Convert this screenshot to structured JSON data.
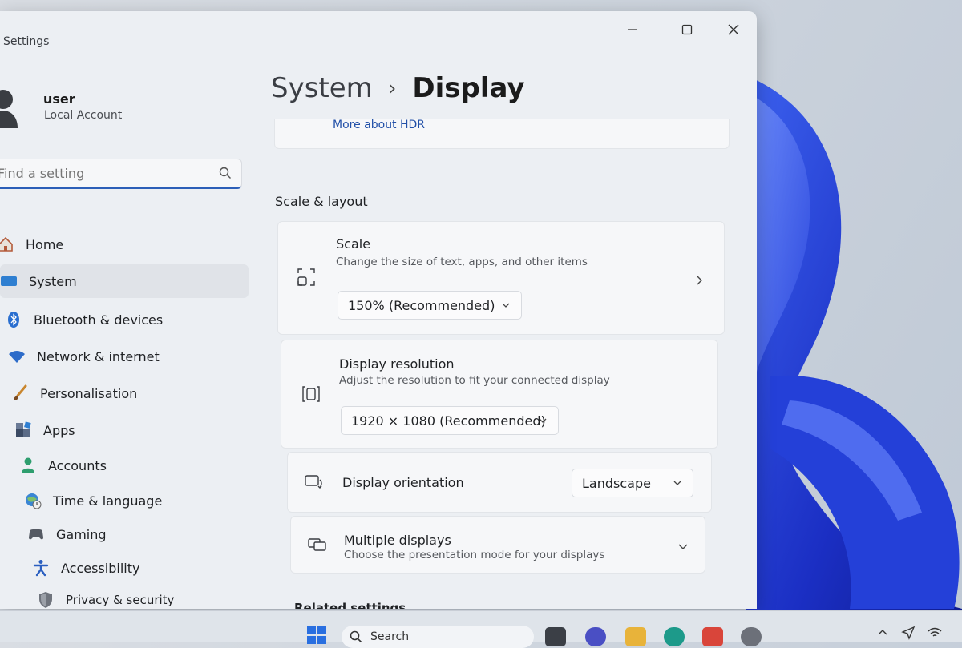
{
  "window": {
    "app_title": "Settings"
  },
  "user": {
    "name": "user",
    "account_type": "Local Account"
  },
  "search": {
    "placeholder": "Find a setting"
  },
  "nav": {
    "items": [
      {
        "label": "Home",
        "icon": "home-icon"
      },
      {
        "label": "System",
        "icon": "system-icon",
        "active": true
      },
      {
        "label": "Bluetooth & devices",
        "icon": "bluetooth-icon"
      },
      {
        "label": "Network & internet",
        "icon": "wifi-icon"
      },
      {
        "label": "Personalisation",
        "icon": "brush-icon"
      },
      {
        "label": "Apps",
        "icon": "apps-icon"
      },
      {
        "label": "Accounts",
        "icon": "accounts-icon"
      },
      {
        "label": "Time & language",
        "icon": "globe-clock-icon"
      },
      {
        "label": "Gaming",
        "icon": "gamepad-icon"
      },
      {
        "label": "Accessibility",
        "icon": "accessibility-icon"
      },
      {
        "label": "Privacy & security",
        "icon": "shield-icon"
      }
    ]
  },
  "breadcrumb": {
    "parent": "System",
    "separator": "›",
    "current": "Display"
  },
  "hdr": {
    "link": "More about HDR"
  },
  "scale_layout": {
    "section_title": "Scale & layout",
    "scale": {
      "title": "Scale",
      "description": "Change the size of text, apps, and other items",
      "value": "150% (Recommended)"
    },
    "resolution": {
      "title": "Display resolution",
      "description": "Adjust the resolution to fit your connected display",
      "value": "1920 × 1080 (Recommended)"
    },
    "orientation": {
      "title": "Display orientation",
      "value": "Landscape"
    },
    "multiple": {
      "title": "Multiple displays",
      "description": "Choose the presentation mode for your displays"
    }
  },
  "related": {
    "title": "Related settings"
  },
  "taskbar": {
    "search_label": "Search"
  },
  "colors": {
    "accent": "#2c5fb8",
    "link": "#2250a8",
    "wallpaper_blue": "#1f3fd6"
  }
}
